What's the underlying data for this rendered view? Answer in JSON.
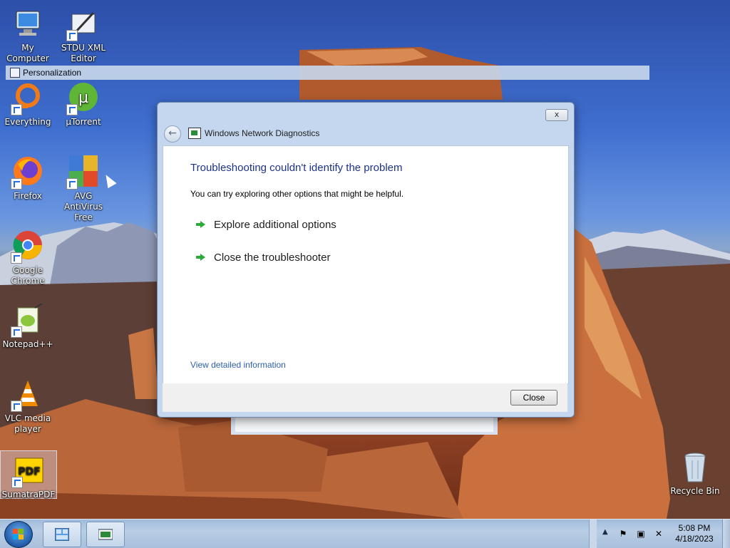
{
  "desktop": {
    "icons": [
      {
        "label": "My Computer",
        "icon": "computer-icon"
      },
      {
        "label": "STDU XML Editor",
        "icon": "xml-editor-icon"
      },
      {
        "label": "Everything",
        "icon": "everything-search-icon"
      },
      {
        "label": "µTorrent",
        "icon": "utorrent-icon"
      },
      {
        "label": "Firefox",
        "icon": "firefox-icon"
      },
      {
        "label": "AVG AntiVirus Free",
        "icon": "avg-antivirus-icon"
      },
      {
        "label": "Google Chrome",
        "icon": "chrome-icon"
      },
      {
        "label": "Notepad++",
        "icon": "notepadpp-icon"
      },
      {
        "label": "VLC media player",
        "icon": "vlc-icon"
      },
      {
        "label": "SumatraPDF",
        "icon": "sumatrapdf-icon"
      },
      {
        "label": "Recycle Bin",
        "icon": "recycle-bin-icon"
      }
    ]
  },
  "personalization": {
    "title": "Personalization"
  },
  "dialog": {
    "title": "Windows Network Diagnostics",
    "close_glyph": "x",
    "back_glyph": "←",
    "heading": "Troubleshooting couldn't identify the problem",
    "subtext": "You can try exploring other options that might be helpful.",
    "options": [
      {
        "label": "Explore additional options"
      },
      {
        "label": "Close the troubleshooter"
      }
    ],
    "details_link": "View detailed information",
    "close_button": "Close"
  },
  "taskbar": {
    "clock_time": "5:08 PM",
    "clock_date": "4/18/2023",
    "tray_up": "▲"
  },
  "colors": {
    "heading": "#1e3287",
    "link": "#2e5fad",
    "arrow": "#2bab3a"
  }
}
